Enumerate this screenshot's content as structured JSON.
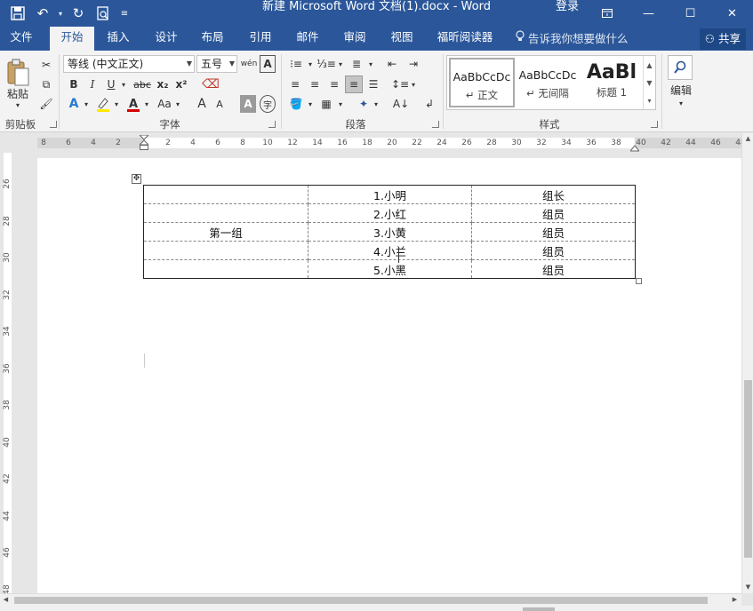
{
  "titlebar": {
    "title": "新建 Microsoft Word 文档(1).docx  -  Word",
    "login": "登录",
    "save_icon": "save-icon",
    "undo_icon": "undo-icon",
    "redo_icon": "redo-icon",
    "preview_icon": "print-preview-icon",
    "customize_icon": "qat-customize-icon",
    "ribbon_display_icon": "ribbon-display-icon",
    "minimize_icon": "minimize-icon",
    "maximize_icon": "maximize-icon",
    "close_icon": "close-icon"
  },
  "tabs": [
    {
      "label": "文件"
    },
    {
      "label": "开始",
      "active": true
    },
    {
      "label": "插入"
    },
    {
      "label": "设计"
    },
    {
      "label": "布局"
    },
    {
      "label": "引用"
    },
    {
      "label": "邮件"
    },
    {
      "label": "审阅"
    },
    {
      "label": "视图"
    },
    {
      "label": "福昕阅读器"
    }
  ],
  "tell_me": "告诉我你想要做什么",
  "share": "共享",
  "ribbon": {
    "clipboard": {
      "paste": "粘贴",
      "label": "剪贴板"
    },
    "font": {
      "font_name": "等线 (中文正文)",
      "font_size": "五号",
      "label": "字体",
      "bold": "B",
      "italic": "I",
      "underline": "U",
      "strike": "abc",
      "subscript": "x₂",
      "superscript": "x²",
      "grow": "A",
      "shrink": "A",
      "case": "Aa",
      "wen": "wén",
      "char_border": "A",
      "char_shade": "A",
      "enclosed": "字"
    },
    "paragraph": {
      "label": "段落"
    },
    "styles": {
      "label": "样式",
      "items": [
        {
          "sample": "AaBbCcDc",
          "name": "↵ 正文"
        },
        {
          "sample": "AaBbCcDc",
          "name": "↵ 无间隔"
        },
        {
          "sample": "AaBl",
          "name": "标题 1"
        }
      ]
    },
    "editing": {
      "label": "编辑"
    }
  },
  "ruler": {
    "corner": "L",
    "h_ticks": [
      "8",
      "6",
      "4",
      "2",
      "",
      "2",
      "4",
      "6",
      "8",
      "10",
      "12",
      "14",
      "16",
      "18",
      "20",
      "22",
      "24",
      "26",
      "28",
      "30",
      "32",
      "34",
      "36",
      "38",
      "40",
      "42",
      "44",
      "46",
      "48"
    ],
    "v_ticks": [
      "26",
      "28",
      "30",
      "32",
      "34",
      "36",
      "38",
      "40",
      "42",
      "44",
      "46",
      "48"
    ]
  },
  "document": {
    "table": [
      [
        "",
        "1.小明",
        "组长"
      ],
      [
        "",
        "2.小红",
        "组员"
      ],
      [
        "第一组",
        "3.小黄",
        "组员"
      ],
      [
        "",
        "4.小兰",
        "组员"
      ],
      [
        "",
        "5.小黑",
        "组员"
      ]
    ]
  }
}
